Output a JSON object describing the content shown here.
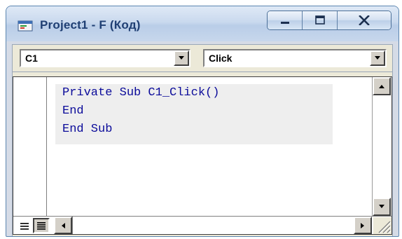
{
  "window": {
    "title": "Project1 - F (Код)"
  },
  "toolbar": {
    "object_combo": {
      "value": "C1"
    },
    "procedure_combo": {
      "value": "Click"
    }
  },
  "editor": {
    "lines": [
      "Private Sub C1_Click()",
      "End",
      "End Sub"
    ],
    "code_color": "#0b0b9a"
  },
  "icons": {
    "app": "vb-code-window-icon",
    "minimize": "minimize-icon",
    "maximize": "maximize-icon",
    "close": "close-icon",
    "dropdown": "down-arrow-icon",
    "procedure_view": "procedure-view-icon",
    "full_module_view": "full-module-view-icon",
    "scroll_left": "left-arrow-icon",
    "scroll_right": "right-arrow-icon",
    "scroll_up": "up-arrow-icon",
    "scroll_down": "down-arrow-icon",
    "resize_grip": "resize-grip-icon"
  }
}
